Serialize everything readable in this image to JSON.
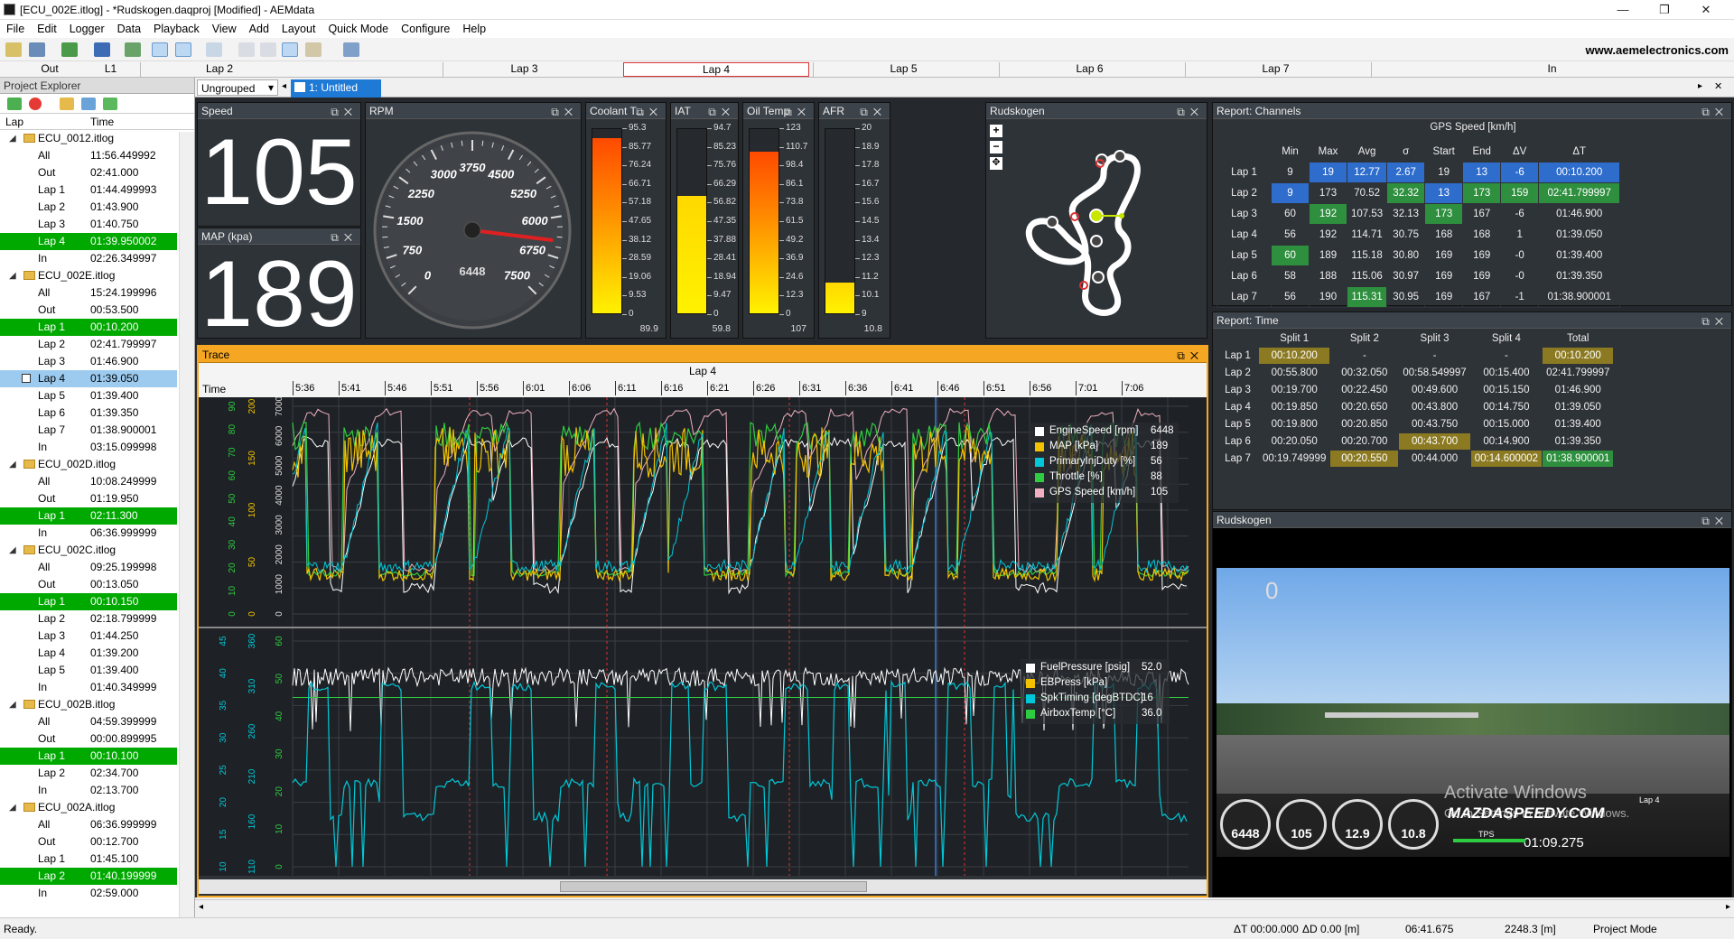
{
  "window": {
    "title": "[ECU_002E.itlog] - *Rudskogen.daqproj [Modified] - AEMdata",
    "min": "—",
    "max": "❐",
    "close": "✕"
  },
  "menu": [
    "File",
    "Edit",
    "Logger",
    "Data",
    "Playback",
    "View",
    "Add",
    "Layout",
    "Quick Mode",
    "Configure",
    "Help"
  ],
  "brand": "www.aemelectronics.com",
  "lapstrip": [
    {
      "label": "Out"
    },
    {
      "label": "L1"
    },
    {
      "label": "Lap 2"
    },
    {
      "label": "Lap 3"
    },
    {
      "label": "Lap 4",
      "active": true
    },
    {
      "label": "Lap 5"
    },
    {
      "label": "Lap 6"
    },
    {
      "label": "Lap 7"
    },
    {
      "label": "In"
    }
  ],
  "project_explorer": {
    "title": "Project Explorer",
    "col_lap": "Lap",
    "col_time": "Time",
    "logs": [
      {
        "name": "ECU_0012.itlog",
        "rows": [
          [
            "All",
            "11:56.449992"
          ],
          [
            "Out",
            "02:41.000"
          ],
          [
            "Lap 1",
            "01:44.499993"
          ],
          [
            "Lap 2",
            "01:43.900"
          ],
          [
            "Lap 3",
            "01:40.750"
          ],
          [
            "Lap 4",
            "01:39.950002",
            "sel"
          ],
          [
            "In",
            "02:26.349997"
          ]
        ]
      },
      {
        "name": "ECU_002E.itlog",
        "rows": [
          [
            "All",
            "15:24.199996"
          ],
          [
            "Out",
            "00:53.500"
          ],
          [
            "Lap 1",
            "00:10.200",
            "sel"
          ],
          [
            "Lap 2",
            "02:41.799997"
          ],
          [
            "Lap 3",
            "01:46.900"
          ],
          [
            "Lap 4",
            "01:39.050",
            "blue"
          ],
          [
            "Lap 5",
            "01:39.400"
          ],
          [
            "Lap 6",
            "01:39.350"
          ],
          [
            "Lap 7",
            "01:38.900001"
          ],
          [
            "In",
            "03:15.099998"
          ]
        ]
      },
      {
        "name": "ECU_002D.itlog",
        "rows": [
          [
            "All",
            "10:08.249999"
          ],
          [
            "Out",
            "01:19.950"
          ],
          [
            "Lap 1",
            "02:11.300",
            "sel"
          ],
          [
            "In",
            "06:36.999999"
          ]
        ]
      },
      {
        "name": "ECU_002C.itlog",
        "rows": [
          [
            "All",
            "09:25.199998"
          ],
          [
            "Out",
            "00:13.050"
          ],
          [
            "Lap 1",
            "00:10.150",
            "sel"
          ],
          [
            "Lap 2",
            "02:18.799999"
          ],
          [
            "Lap 3",
            "01:44.250"
          ],
          [
            "Lap 4",
            "01:39.200"
          ],
          [
            "Lap 5",
            "01:39.400"
          ],
          [
            "In",
            "01:40.349999"
          ]
        ]
      },
      {
        "name": "ECU_002B.itlog",
        "rows": [
          [
            "All",
            "04:59.399999"
          ],
          [
            "Out",
            "00:00.899995"
          ],
          [
            "Lap 1",
            "00:10.100",
            "sel"
          ],
          [
            "Lap 2",
            "02:34.700"
          ],
          [
            "In",
            "02:13.700"
          ]
        ]
      },
      {
        "name": "ECU_002A.itlog",
        "rows": [
          [
            "All",
            "06:36.999999"
          ],
          [
            "Out",
            "00:12.700"
          ],
          [
            "Lap 1",
            "01:45.100"
          ],
          [
            "Lap 2",
            "01:40.199999",
            "sel"
          ],
          [
            "In",
            "02:59.000"
          ]
        ]
      }
    ]
  },
  "tabs": {
    "group": "Ungrouped",
    "doc": "1: Untitled"
  },
  "speed": {
    "title": "Speed",
    "value": "105"
  },
  "map": {
    "title": "MAP (kpa)",
    "value": "189"
  },
  "rpm": {
    "title": "RPM",
    "value": "6448",
    "ticks": [
      "0",
      "750",
      "1500",
      "2250",
      "3000",
      "3750",
      "4500",
      "5250",
      "6000",
      "6750",
      "7500"
    ],
    "fraction": 0.8597
  },
  "bars": [
    {
      "title": "Coolant T...",
      "ticks": [
        "95.3",
        "85.77",
        "76.24",
        "66.71",
        "57.18",
        "47.65",
        "38.12",
        "28.59",
        "19.06",
        "9.53",
        "0"
      ],
      "value": "89.9",
      "fraction": 0.943,
      "color": "orange"
    },
    {
      "title": "IAT",
      "ticks": [
        "94.7",
        "85.23",
        "75.76",
        "66.29",
        "56.82",
        "47.35",
        "37.88",
        "28.41",
        "18.94",
        "9.47",
        "0"
      ],
      "value": "59.8",
      "fraction": 0.631,
      "color": "yellow"
    },
    {
      "title": "Oil Temp",
      "ticks": [
        "123",
        "110.7",
        "98.4",
        "86.1",
        "73.8",
        "61.5",
        "49.2",
        "36.9",
        "24.6",
        "12.3",
        "0"
      ],
      "value": "107",
      "fraction": 0.87,
      "color": "orange"
    },
    {
      "title": "AFR",
      "ticks": [
        "20",
        "18.9",
        "17.8",
        "16.7",
        "15.6",
        "14.5",
        "13.4",
        "12.3",
        "11.2",
        "10.1",
        "9"
      ],
      "value": "10.8",
      "fraction": 0.164,
      "color": "yellow"
    }
  ],
  "map_panel": {
    "title": "Rudskogen",
    "zoom_in": "+",
    "zoom_out": "−",
    "fit": "✥"
  },
  "report_channels": {
    "title": "Report: Channels",
    "group": "GPS Speed [km/h]",
    "headers": [
      "",
      "Min",
      "Max",
      "Avg",
      "σ",
      "Start",
      "End",
      "ΔV",
      "ΔT"
    ],
    "rows": [
      [
        "Lap 1",
        "9",
        "19",
        "12.77",
        "2.67",
        "19",
        "13",
        "-6",
        "00:10.200"
      ],
      [
        "Lap 2",
        "9",
        "173",
        "70.52",
        "32.32",
        "13",
        "173",
        "159",
        "02:41.799997"
      ],
      [
        "Lap 3",
        "60",
        "192",
        "107.53",
        "32.13",
        "173",
        "167",
        "-6",
        "01:46.900"
      ],
      [
        "Lap 4",
        "56",
        "192",
        "114.71",
        "30.75",
        "168",
        "168",
        "1",
        "01:39.050"
      ],
      [
        "Lap 5",
        "60",
        "189",
        "115.18",
        "30.80",
        "169",
        "169",
        "-0",
        "01:39.400"
      ],
      [
        "Lap 6",
        "58",
        "188",
        "115.06",
        "30.97",
        "169",
        "169",
        "-0",
        "01:39.350"
      ],
      [
        "Lap 7",
        "56",
        "190",
        "115.31",
        "30.95",
        "169",
        "167",
        "-1",
        "01:38.900001"
      ]
    ]
  },
  "report_time": {
    "title": "Report: Time",
    "headers": [
      "",
      "Split 1",
      "Split 2",
      "Split 3",
      "Split 4",
      "Total"
    ],
    "rows": [
      [
        "Lap 1",
        "00:10.200",
        "-",
        "-",
        "-",
        "00:10.200"
      ],
      [
        "Lap 2",
        "00:55.800",
        "00:32.050",
        "00:58.549997",
        "00:15.400",
        "02:41.799997"
      ],
      [
        "Lap 3",
        "00:19.700",
        "00:22.450",
        "00:49.600",
        "00:15.150",
        "01:46.900"
      ],
      [
        "Lap 4",
        "00:19.850",
        "00:20.650",
        "00:43.800",
        "00:14.750",
        "01:39.050"
      ],
      [
        "Lap 5",
        "00:19.800",
        "00:20.850",
        "00:43.750",
        "00:15.000",
        "01:39.400"
      ],
      [
        "Lap 6",
        "00:20.050",
        "00:20.700",
        "00:43.700",
        "00:14.900",
        "01:39.350"
      ],
      [
        "Lap 7",
        "00:19.749999",
        "00:20.550",
        "00:44.000",
        "00:14.600002",
        "01:38.900001"
      ]
    ]
  },
  "video": {
    "title": "Rudskogen",
    "counter": "0",
    "watermark1": "Activate Windows",
    "watermark2": "Go to Settings to activate Windows.",
    "overlay_brand": "MAZDASPEEDY.COM",
    "overlay_time": "01:09.275",
    "overlay_tps": "TPS",
    "overlay_lap": "Lap 4",
    "overlay_gauges": [
      "6448",
      "105",
      "12.9",
      "10.8"
    ]
  },
  "trace": {
    "title": "Trace",
    "lap": "Lap 4",
    "axis_label": "Time",
    "time_ticks": [
      "5:36",
      "5:41",
      "5:46",
      "5:51",
      "5:56",
      "6:01",
      "6:06",
      "6:11",
      "6:16",
      "6:21",
      "6:26",
      "6:31",
      "6:36",
      "6:41",
      "6:46",
      "6:51",
      "6:56",
      "7:01",
      "7:06"
    ],
    "top_legend": [
      {
        "name": "EngineSpeed [rpm]",
        "value": "6448",
        "color": "#ffffff"
      },
      {
        "name": "MAP [kPa]",
        "value": "189",
        "color": "#f2c200"
      },
      {
        "name": "PrimaryInjDuty [%]",
        "value": "56",
        "color": "#00c8d8"
      },
      {
        "name": "Throttle [%]",
        "value": "88",
        "color": "#2ecc40"
      },
      {
        "name": "GPS Speed [km/h]",
        "value": "105",
        "color": "#f0b0c0"
      }
    ],
    "bottom_legend": [
      {
        "name": "FuelPressure [psig]",
        "value": "52.0",
        "color": "#ffffff"
      },
      {
        "name": "EBPress [kPa]",
        "value": "",
        "color": "#f2c200"
      },
      {
        "name": "SpkTiming [degBTDC]",
        "value": "16",
        "color": "#00c8d8"
      },
      {
        "name": "AirboxTemp [°C]",
        "value": "36.0",
        "color": "#2ecc40"
      }
    ],
    "top_axes": {
      "rpm": [
        "0",
        "1000",
        "2000",
        "3000",
        "4000",
        "5000",
        "6000",
        "7000"
      ],
      "kpa": [
        "0",
        "50",
        "100",
        "150",
        "200"
      ],
      "pct": [
        "0",
        "10",
        "20",
        "30",
        "40",
        "50",
        "60",
        "70",
        "80",
        "90"
      ]
    },
    "bottom_axes": {
      "a": [
        "10",
        "15",
        "20",
        "25",
        "30",
        "35",
        "40",
        "45"
      ],
      "b": [
        "110",
        "160",
        "210",
        "260",
        "310",
        "360"
      ],
      "c": [
        "0",
        "10",
        "20",
        "30",
        "40",
        "50",
        "60"
      ]
    }
  },
  "status": {
    "ready": "Ready.",
    "dt": "ΔT 00:00.000",
    "dd": "ΔD 0.00 [m]",
    "time": "06:41.675",
    "dist": "2248.3 [m]",
    "mode": "Project Mode"
  }
}
